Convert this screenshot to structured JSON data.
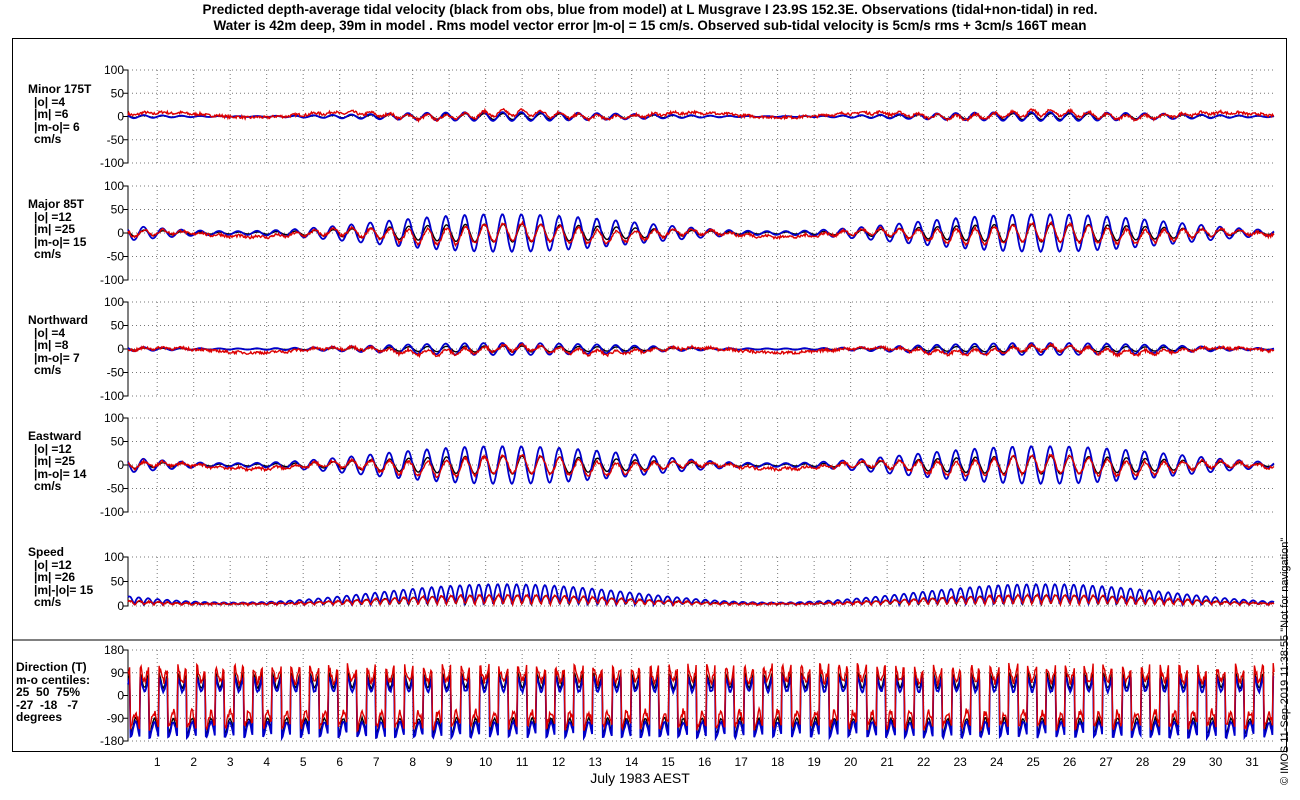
{
  "title_line1": "Predicted depth-average tidal velocity (black from obs, blue from model) at L Musgrave I 23.9S 152.3E. Observations (tidal+non-tidal) in red.",
  "title_line2": "Water is 42m deep, 39m in model . Rms model vector error |m-o| = 15 cm/s. Observed sub-tidal velocity is 5cm/s rms + 3cm/s 166T mean",
  "xlabel": "July 1983 AEST",
  "credit": "© IMOS 11-Sep-2019 11:38:55  \"Not for navigation\"",
  "panels": [
    {
      "key": "minor",
      "label_lines": [
        "Minor 175T",
        "|o| =4",
        "|m| =6",
        "|m-o|= 6",
        "cm/s"
      ]
    },
    {
      "key": "major",
      "label_lines": [
        "Major 85T",
        "|o| =12",
        "|m| =25",
        "|m-o|= 15",
        "cm/s"
      ]
    },
    {
      "key": "north",
      "label_lines": [
        "Northward",
        "|o| =4",
        "|m| =8",
        "|m-o|= 7",
        "cm/s"
      ]
    },
    {
      "key": "east",
      "label_lines": [
        "Eastward",
        "|o| =12",
        "|m| =25",
        "|m-o|= 14",
        "cm/s"
      ]
    },
    {
      "key": "speed",
      "label_lines": [
        "Speed",
        "|o| =12",
        "|m| =26",
        "|m|-|o|= 15",
        "cm/s"
      ]
    },
    {
      "key": "direction",
      "label_lines": [
        "Direction (T)",
        "m-o centiles:",
        "25  50  75%",
        "-27  -18   -7",
        "degrees"
      ]
    }
  ],
  "chart_data": [
    {
      "type": "line",
      "panel": "Minor 175T",
      "ylim": [
        -100,
        100
      ],
      "yticks": [
        100,
        50,
        0,
        -50,
        -100
      ],
      "xlim": [
        0.2,
        31.6
      ],
      "series": [
        {
          "color": "#000000",
          "amplitude": 4,
          "mean": 0
        },
        {
          "color": "#0000cc",
          "amplitude": 6,
          "mean": 0
        },
        {
          "color": "#dd0000",
          "amplitude": 4,
          "mean": 3
        }
      ]
    },
    {
      "type": "line",
      "panel": "Major 85T",
      "ylim": [
        -100,
        100
      ],
      "yticks": [
        100,
        50,
        0,
        -50,
        -100
      ],
      "xlim": [
        0.2,
        31.6
      ],
      "series": [
        {
          "color": "#000000",
          "amplitude": 12,
          "mean": 0
        },
        {
          "color": "#0000cc",
          "amplitude": 25,
          "mean": 0
        },
        {
          "color": "#dd0000",
          "amplitude": 12,
          "mean": -3
        }
      ]
    },
    {
      "type": "line",
      "panel": "Northward",
      "ylim": [
        -100,
        100
      ],
      "yticks": [
        100,
        50,
        0,
        -50,
        -100
      ],
      "xlim": [
        0.2,
        31.6
      ],
      "series": [
        {
          "color": "#000000",
          "amplitude": 4,
          "mean": 0
        },
        {
          "color": "#0000cc",
          "amplitude": 8,
          "mean": 0
        },
        {
          "color": "#dd0000",
          "amplitude": 4,
          "mean": -3
        }
      ]
    },
    {
      "type": "line",
      "panel": "Eastward",
      "ylim": [
        -100,
        100
      ],
      "yticks": [
        100,
        50,
        0,
        -50,
        -100
      ],
      "xlim": [
        0.2,
        31.6
      ],
      "series": [
        {
          "color": "#000000",
          "amplitude": 12,
          "mean": 0
        },
        {
          "color": "#0000cc",
          "amplitude": 25,
          "mean": 0
        },
        {
          "color": "#dd0000",
          "amplitude": 12,
          "mean": -3
        }
      ]
    },
    {
      "type": "line",
      "panel": "Speed",
      "ylim": [
        0,
        100
      ],
      "yticks": [
        100,
        50,
        0
      ],
      "xlim": [
        0.2,
        31.6
      ],
      "series": [
        {
          "color": "#000000",
          "mean": 12
        },
        {
          "color": "#0000cc",
          "mean": 26
        },
        {
          "color": "#dd0000",
          "mean": 12
        }
      ]
    },
    {
      "type": "line",
      "panel": "Direction (T)",
      "ylim": [
        -180,
        180
      ],
      "yticks": [
        180,
        90,
        0,
        -90,
        -180
      ],
      "xlim": [
        0.2,
        31.6
      ],
      "series": [
        {
          "color": "#000000"
        },
        {
          "color": "#0000cc"
        },
        {
          "color": "#dd0000"
        }
      ]
    }
  ],
  "x_ticks": [
    1,
    2,
    3,
    4,
    5,
    6,
    7,
    8,
    9,
    10,
    11,
    12,
    13,
    14,
    15,
    16,
    17,
    18,
    19,
    20,
    21,
    22,
    23,
    24,
    25,
    26,
    27,
    28,
    29,
    30,
    31
  ],
  "grid": true
}
